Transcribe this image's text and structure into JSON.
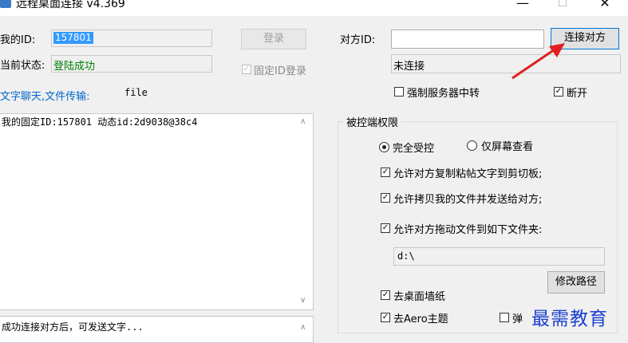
{
  "window": {
    "title": "远程桌面连接 v4.369",
    "minimize": "—",
    "maximize": "☐",
    "close": "✕"
  },
  "left": {
    "my_id_label": "我的ID:",
    "my_id_value": "157801",
    "login_button": "登录",
    "status_label": "当前状态:",
    "status_value": "登陆成功",
    "fixed_id_login": "固定ID登录",
    "chat_link": "文字聊天,文件传输:",
    "file_label": "file",
    "info_text": "我的固定ID:157801 动态id:2d9038@38c4",
    "chat_hint": "成功连接对方后，可发送文字..."
  },
  "right": {
    "peer_id_label": "对方ID:",
    "peer_id_value": "",
    "connect_button": "连接对方",
    "connection_status": "未连接",
    "force_relay": "强制服务器中转",
    "disconnect": "断开",
    "group_title": "被控端权限",
    "radio_full": "完全受控",
    "radio_view": "仅屏幕查看",
    "perm_clipboard": "允许对方复制粘帖文字到剪切板;",
    "perm_copy_files": "允许拷贝我的文件并发送给对方;",
    "perm_drag_files": "允许对方拖动文件到如下文件夹:",
    "folder_path": "d:\\",
    "change_path_button": "修改路径",
    "remove_wallpaper": "去桌面墙纸",
    "remove_aero": "去Aero主题",
    "popup_partial": "弹",
    "watermark": "最需教育"
  },
  "colors": {
    "selection": "#3399ff",
    "status_green": "#008000",
    "link_blue": "#0066cc",
    "arrow_red": "#e02020",
    "focus_blue": "#0078d7"
  }
}
